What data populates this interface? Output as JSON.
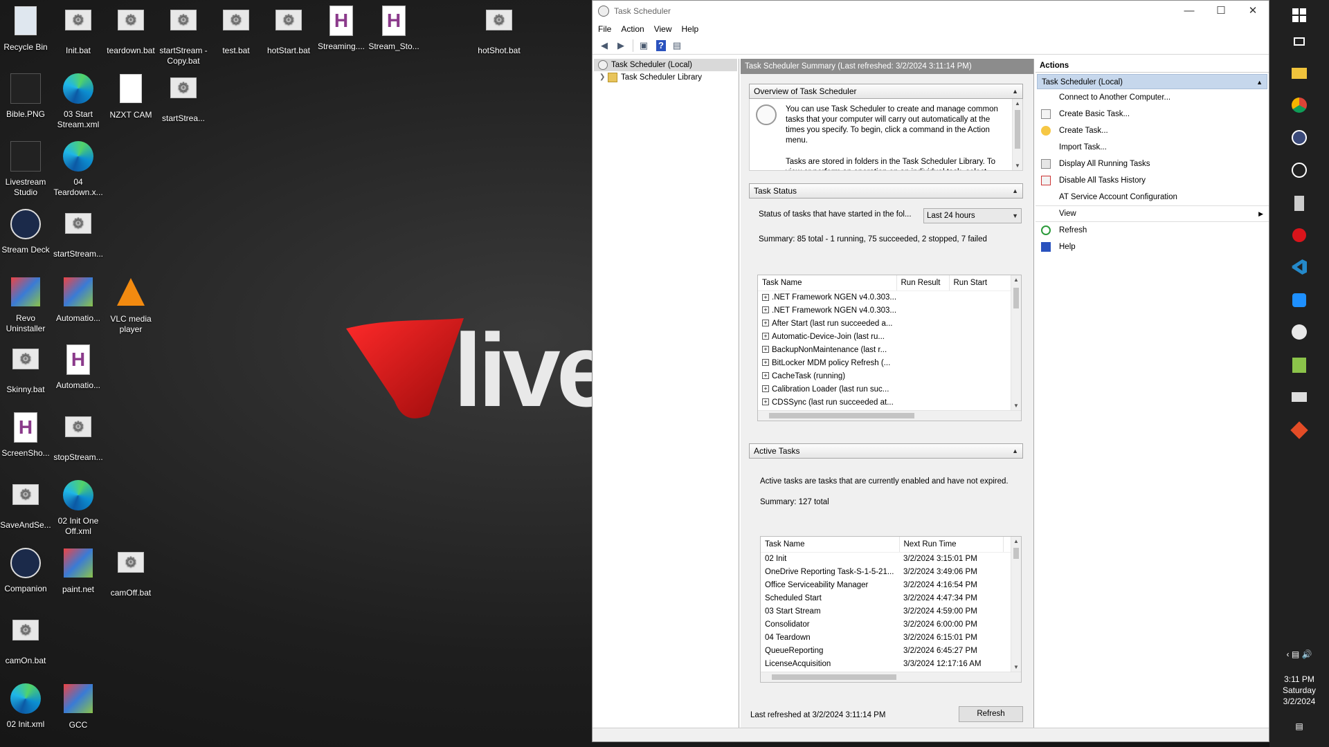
{
  "desktop": {
    "brand_text": "live",
    "icons": [
      {
        "label": "Recycle Bin",
        "kind": "recycle"
      },
      {
        "label": "Init.bat",
        "kind": "bat"
      },
      {
        "label": "teardown.bat",
        "kind": "bat"
      },
      {
        "label": "startStream - Copy.bat",
        "kind": "bat"
      },
      {
        "label": "test.bat",
        "kind": "bat"
      },
      {
        "label": "hotStart.bat",
        "kind": "bat"
      },
      {
        "label": "Streaming....",
        "kind": "h"
      },
      {
        "label": "Stream_Sto...",
        "kind": "h"
      },
      {
        "label": "hotShot.bat",
        "kind": "bat"
      },
      {
        "label": "Bible.PNG",
        "kind": "dark"
      },
      {
        "label": "03 Start Stream.xml",
        "kind": "edge"
      },
      {
        "label": "NZXT CAM",
        "kind": "plain"
      },
      {
        "label": "startStrea...",
        "kind": "bat"
      },
      {
        "label": "Livestream Studio",
        "kind": "dark"
      },
      {
        "label": "04 Teardown.x...",
        "kind": "edge"
      },
      {
        "label": "Stream Deck",
        "kind": "circle"
      },
      {
        "label": "startStream...",
        "kind": "bat"
      },
      {
        "label": "Revo Uninstaller",
        "kind": "color"
      },
      {
        "label": "Automatio...",
        "kind": "color"
      },
      {
        "label": "VLC media player",
        "kind": "cone"
      },
      {
        "label": "Skinny.bat",
        "kind": "bat"
      },
      {
        "label": "Automatio...",
        "kind": "h"
      },
      {
        "label": "ScreenSho...",
        "kind": "h"
      },
      {
        "label": "stopStream...",
        "kind": "bat"
      },
      {
        "label": "SaveAndSe...",
        "kind": "bat"
      },
      {
        "label": "02 Init One Off.xml",
        "kind": "edge"
      },
      {
        "label": "Companion",
        "kind": "circle"
      },
      {
        "label": "paint.net",
        "kind": "color"
      },
      {
        "label": "camOff.bat",
        "kind": "bat"
      },
      {
        "label": "camOn.bat",
        "kind": "bat"
      },
      {
        "label": "02 Init.xml",
        "kind": "edge"
      },
      {
        "label": "GCC",
        "kind": "color"
      }
    ]
  },
  "window": {
    "title": "Task Scheduler",
    "menu": [
      "File",
      "Action",
      "View",
      "Help"
    ],
    "tree": {
      "root": "Task Scheduler (Local)",
      "library": "Task Scheduler Library"
    },
    "center": {
      "header": "Task Scheduler Summary (Last refreshed: 3/2/2024 3:11:14 PM)",
      "overview": {
        "title": "Overview of Task Scheduler",
        "text1": "You can use Task Scheduler to create and manage common tasks that your computer will carry out automatically at the times you specify. To begin, click a command in the Action menu.",
        "text2": "Tasks are stored in folders in the Task Scheduler Library. To view or perform an operation on an individual task, select"
      },
      "task_status": {
        "title": "Task Status",
        "status_label": "Status of tasks that have started in the fol...",
        "dropdown_value": "Last 24 hours",
        "summary": "Summary: 85 total - 1 running, 75 succeeded, 2 stopped, 7 failed",
        "columns": [
          "Task Name",
          "Run Result",
          "Run Start"
        ],
        "rows": [
          ".NET Framework NGEN v4.0.303...",
          ".NET Framework NGEN v4.0.303...",
          "After Start (last run succeeded a...",
          "Automatic-Device-Join (last ru...",
          "BackupNonMaintenance (last r...",
          "BitLocker MDM policy Refresh (...",
          "CacheTask (running)",
          "Calibration Loader (last run suc...",
          "CDSSync (last run succeeded at..."
        ]
      },
      "active_tasks": {
        "title": "Active Tasks",
        "description": "Active tasks are tasks that are currently enabled and have not expired.",
        "summary": "Summary: 127 total",
        "columns": [
          "Task Name",
          "Next Run Time"
        ],
        "rows": [
          {
            "name": "02 Init",
            "next": "3/2/2024 3:15:01 PM"
          },
          {
            "name": "OneDrive Reporting Task-S-1-5-21...",
            "next": "3/2/2024 3:49:06 PM"
          },
          {
            "name": "Office Serviceability Manager",
            "next": "3/2/2024 4:16:54 PM"
          },
          {
            "name": "Scheduled Start",
            "next": "3/2/2024 4:47:34 PM"
          },
          {
            "name": "03 Start Stream",
            "next": "3/2/2024 4:59:00 PM"
          },
          {
            "name": "Consolidator",
            "next": "3/2/2024 6:00:00 PM"
          },
          {
            "name": "04 Teardown",
            "next": "3/2/2024 6:15:01 PM"
          },
          {
            "name": "QueueReporting",
            "next": "3/2/2024 6:45:27 PM"
          },
          {
            "name": "LicenseAcquisition",
            "next": "3/3/2024 12:17:16 AM"
          }
        ]
      },
      "footer": {
        "last_refreshed": "Last refreshed at 3/2/2024 3:11:14 PM",
        "refresh_button": "Refresh"
      }
    },
    "actions": {
      "header": "Actions",
      "group": "Task Scheduler (Local)",
      "items": [
        {
          "label": "Connect to Another Computer...",
          "icon": "none"
        },
        {
          "label": "Create Basic Task...",
          "icon": "create-basic-task-icon"
        },
        {
          "label": "Create Task...",
          "icon": "create-task-icon"
        },
        {
          "label": "Import Task...",
          "icon": "none"
        },
        {
          "label": "Display All Running Tasks",
          "icon": "running-tasks-icon"
        },
        {
          "label": "Disable All Tasks History",
          "icon": "history-icon"
        },
        {
          "label": "AT Service Account Configuration",
          "icon": "none"
        },
        {
          "label": "View",
          "icon": "none",
          "submenu": true
        },
        {
          "label": "Refresh",
          "icon": "refresh-icon"
        },
        {
          "label": "Help",
          "icon": "help-icon"
        }
      ]
    }
  },
  "taskbar": {
    "time": "3:11 PM",
    "day": "Saturday",
    "date": "3/2/2024"
  },
  "colors": {
    "accent_selection": "#c6d7ec",
    "center_header": "#8c8c8c",
    "taskbar": "#202020",
    "brand_red": "#d9141b"
  }
}
